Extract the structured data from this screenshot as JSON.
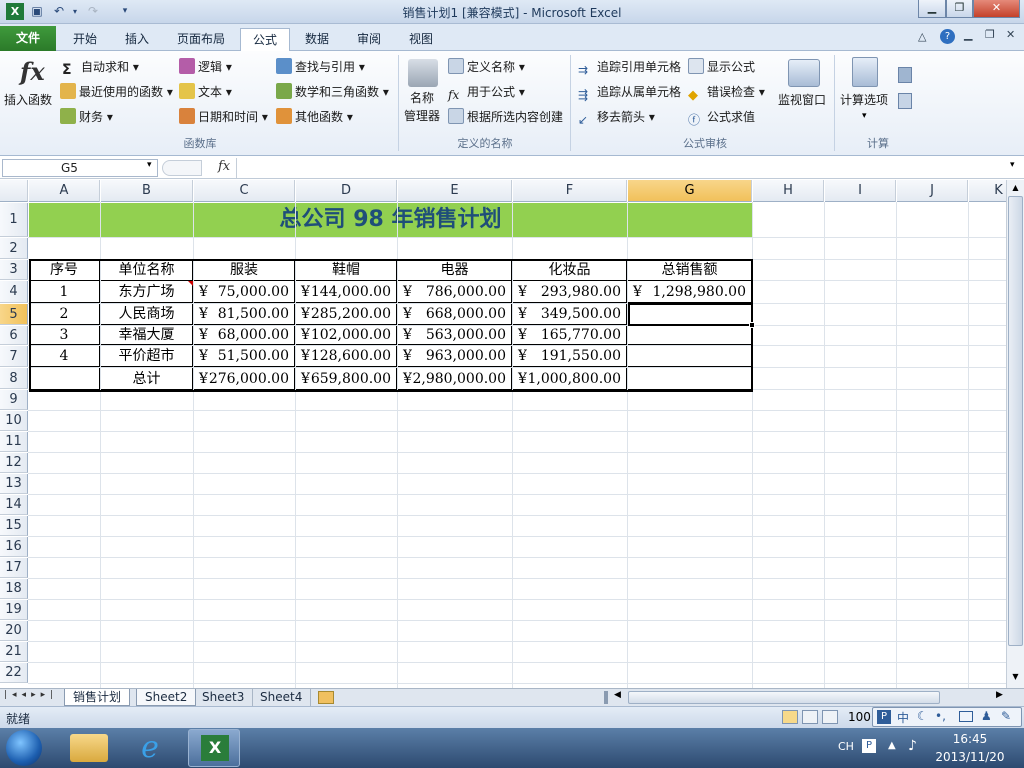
{
  "window": {
    "title": "销售计划1 [兼容模式] - Microsoft Excel"
  },
  "tabs": {
    "file": "文件",
    "items": [
      "开始",
      "插入",
      "页面布局",
      "公式",
      "数据",
      "审阅",
      "视图"
    ],
    "active": "公式"
  },
  "ribbon": {
    "insert_function": "插入函数",
    "autosum": "自动求和",
    "recent": "最近使用的函数",
    "finance": "财务",
    "logic": "逻辑",
    "text": "文本",
    "datetime": "日期和时间",
    "lookup": "查找与引用",
    "math": "数学和三角函数",
    "other": "其他函数",
    "group_library": "函数库",
    "name_manager_1": "名称",
    "name_manager_2": "管理器",
    "define_name": "定义名称",
    "use_in_formula": "用于公式",
    "create_from_sel": "根据所选内容创建",
    "group_names": "定义的名称",
    "trace_precedents": "追踪引用单元格",
    "trace_dependents": "追踪从属单元格",
    "remove_arrows": "移去箭头",
    "show_formulas": "显示公式",
    "error_check": "错误检查",
    "eval_formula": "公式求值",
    "watch_window": "监视窗口",
    "group_audit": "公式审核",
    "calc_options": "计算选项",
    "group_calc": "计算"
  },
  "formula_bar": {
    "name_box": "G5",
    "fx": "fx",
    "content": ""
  },
  "columns": [
    "A",
    "B",
    "C",
    "D",
    "E",
    "F",
    "G",
    "H",
    "I",
    "J",
    "K"
  ],
  "rows": [
    "1",
    "2",
    "3",
    "4",
    "5",
    "6",
    "7",
    "8",
    "9",
    "10",
    "11",
    "12",
    "13",
    "14",
    "15",
    "16",
    "17",
    "18",
    "19",
    "20",
    "21",
    "22"
  ],
  "sheet": {
    "title": "总公司 98 年销售计划",
    "headers": [
      "序号",
      "单位名称",
      "服装",
      "鞋帽",
      "电器",
      "化妆品",
      "总销售额"
    ],
    "currency": "¥",
    "data": [
      [
        "1",
        "东方广场",
        "75,000.00",
        "144,000.00",
        "786,000.00",
        "293,980.00",
        "1,298,980.00"
      ],
      [
        "2",
        "人民商场",
        "81,500.00",
        "285,200.00",
        "668,000.00",
        "349,500.00",
        ""
      ],
      [
        "3",
        "幸福大厦",
        "68,000.00",
        "102,000.00",
        "563,000.00",
        "165,770.00",
        ""
      ],
      [
        "4",
        "平价超市",
        "51,500.00",
        "128,600.00",
        "963,000.00",
        "191,550.00",
        ""
      ]
    ],
    "total_label": "总计",
    "totals": [
      "276,000.00",
      "659,800.00",
      "2,980,000.00",
      "1,000,800.00"
    ]
  },
  "sheet_tabs": [
    "销售计划",
    "Sheet2",
    "Sheet3",
    "Sheet4"
  ],
  "status": {
    "ready": "就绪",
    "zoom": "100"
  },
  "taskbar": {
    "lang": "CH",
    "time": "16:45",
    "date": "2013/11/20",
    "ime": [
      "中",
      "•,"
    ]
  },
  "colors": {
    "title_fill": "#92d050",
    "title_text": "#1f4e79",
    "selected_header": "#f1c15a",
    "file_tab": "#2b7a29"
  }
}
